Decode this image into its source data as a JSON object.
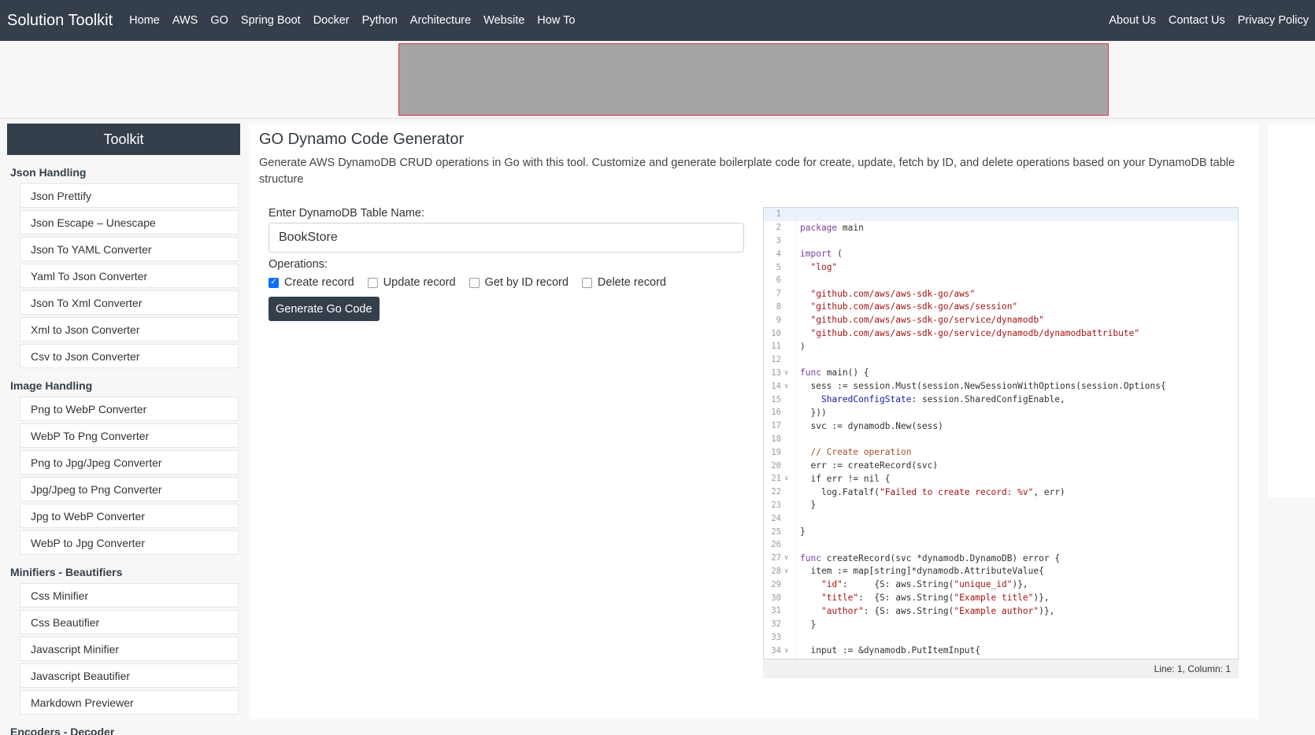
{
  "brand": "Solution Toolkit",
  "nav_left": [
    "Home",
    "AWS",
    "GO",
    "Spring Boot",
    "Docker",
    "Python",
    "Architecture",
    "Website",
    "How To"
  ],
  "nav_right": [
    "About Us",
    "Contact Us",
    "Privacy Policy"
  ],
  "sidebar": {
    "header": "Toolkit",
    "sections": [
      {
        "title": "Json Handling",
        "items": [
          "Json Prettify",
          "Json Escape – Unescape",
          "Json To YAML Converter",
          "Yaml To Json Converter",
          "Json To Xml Converter",
          "Xml to Json Converter",
          "Csv to Json Converter"
        ]
      },
      {
        "title": "Image Handling",
        "items": [
          "Png to WebP Converter",
          "WebP To Png Converter",
          "Png to Jpg/Jpeg Converter",
          "Jpg/Jpeg to Png Converter",
          "Jpg to WebP Converter",
          "WebP to Jpg Converter"
        ]
      },
      {
        "title": "Minifiers - Beautifiers",
        "items": [
          "Css Minifier",
          "Css Beautifier",
          "Javascript Minifier",
          "Javascript Beautifier",
          "Markdown Previewer"
        ]
      },
      {
        "title": "Encoders - Decoder",
        "items": []
      }
    ]
  },
  "main": {
    "title": "GO Dynamo Code Generator",
    "description": "Generate AWS DynamoDB CRUD operations in Go with this tool. Customize and generate boilerplate code for create, update, fetch by ID, and delete operations based on your DynamoDB table structure",
    "table_label": "Enter DynamoDB Table Name:",
    "table_value": "BookStore",
    "operations_label": "Operations:",
    "operations": [
      {
        "label": "Create record",
        "checked": true
      },
      {
        "label": "Update record",
        "checked": false
      },
      {
        "label": "Get by ID record",
        "checked": false
      },
      {
        "label": "Delete record",
        "checked": false
      }
    ],
    "generate_label": "Generate Go Code"
  },
  "editor": {
    "status": "Line: 1, Column: 1",
    "lines": [
      {
        "n": "1",
        "t": ""
      },
      {
        "n": "2",
        "t": "package main"
      },
      {
        "n": "3",
        "t": ""
      },
      {
        "n": "4",
        "t": "import ("
      },
      {
        "n": "5",
        "t": "  \"log\""
      },
      {
        "n": "6",
        "t": ""
      },
      {
        "n": "7",
        "t": "  \"github.com/aws/aws-sdk-go/aws\""
      },
      {
        "n": "8",
        "t": "  \"github.com/aws/aws-sdk-go/aws/session\""
      },
      {
        "n": "9",
        "t": "  \"github.com/aws/aws-sdk-go/service/dynamodb\""
      },
      {
        "n": "10",
        "t": "  \"github.com/aws/aws-sdk-go/service/dynamodb/dynamodbattribute\""
      },
      {
        "n": "11",
        "t": ")"
      },
      {
        "n": "12",
        "t": ""
      },
      {
        "n": "13",
        "t": "func main() {",
        "fold": true
      },
      {
        "n": "14",
        "t": "  sess := session.Must(session.NewSessionWithOptions(session.Options{",
        "fold": true
      },
      {
        "n": "15",
        "t": "    SharedConfigState: session.SharedConfigEnable,"
      },
      {
        "n": "16",
        "t": "  }))"
      },
      {
        "n": "17",
        "t": "  svc := dynamodb.New(sess)"
      },
      {
        "n": "18",
        "t": ""
      },
      {
        "n": "19",
        "t": "  // Create operation"
      },
      {
        "n": "20",
        "t": "  err := createRecord(svc)"
      },
      {
        "n": "21",
        "t": "  if err != nil {",
        "fold": true
      },
      {
        "n": "22",
        "t": "    log.Fatalf(\"Failed to create record: %v\", err)"
      },
      {
        "n": "23",
        "t": "  }"
      },
      {
        "n": "24",
        "t": ""
      },
      {
        "n": "25",
        "t": "}"
      },
      {
        "n": "26",
        "t": ""
      },
      {
        "n": "27",
        "t": "func createRecord(svc *dynamodb.DynamoDB) error {",
        "fold": true
      },
      {
        "n": "28",
        "t": "  item := map[string]*dynamodb.AttributeValue{",
        "fold": true
      },
      {
        "n": "29",
        "t": "    \"id\":     {S: aws.String(\"unique_id\")},"
      },
      {
        "n": "30",
        "t": "    \"title\":  {S: aws.String(\"Example title\")},"
      },
      {
        "n": "31",
        "t": "    \"author\": {S: aws.String(\"Example author\")},"
      },
      {
        "n": "32",
        "t": "  }"
      },
      {
        "n": "33",
        "t": ""
      },
      {
        "n": "34",
        "t": "  input := &dynamodb.PutItemInput{",
        "fold": true
      }
    ]
  }
}
